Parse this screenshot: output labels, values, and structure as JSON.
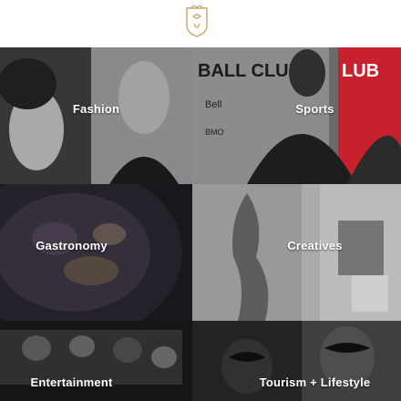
{
  "header": {
    "logo_icon": "crest-monogram-icon"
  },
  "categories": [
    {
      "label": "Fashion"
    },
    {
      "label": "Sports"
    },
    {
      "label": "Gastronomy"
    },
    {
      "label": "Creatives"
    },
    {
      "label": "Entertainment"
    },
    {
      "label": "Tourism + Lifestyle"
    }
  ],
  "sports_photo_text": {
    "banner_left": "BALL CLUB",
    "banner_right": "LUB",
    "sponsor_1": "Bell",
    "sponsor_2": "BMO"
  },
  "colors": {
    "accent_gold": "#c9a46a",
    "sports_red": "#c8202c"
  }
}
